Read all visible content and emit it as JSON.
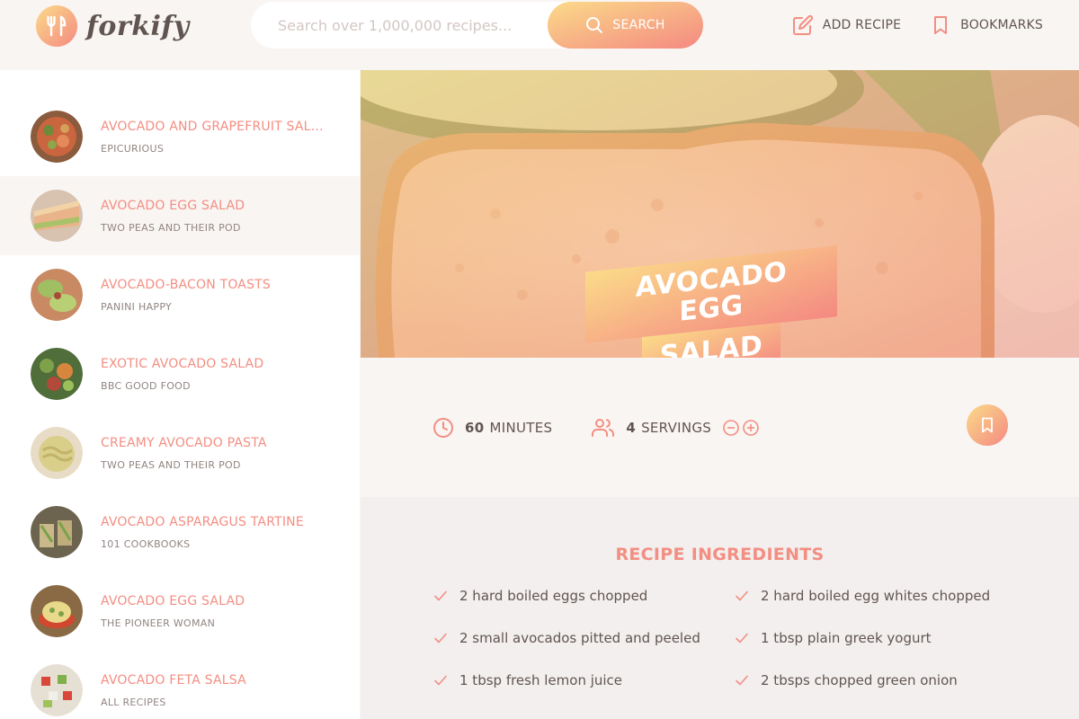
{
  "header": {
    "logo_text": "forkify",
    "search_placeholder": "Search over 1,000,000 recipes...",
    "search_label": "SEARCH",
    "nav": [
      {
        "label": "ADD RECIPE",
        "icon": "edit-icon"
      },
      {
        "label": "BOOKMARKS",
        "icon": "bookmark-icon"
      }
    ]
  },
  "results": [
    {
      "title": "AVOCADO AND GRAPEFRUIT SAL...",
      "publisher": "EPICURIOUS",
      "active": false
    },
    {
      "title": "AVOCADO EGG SALAD",
      "publisher": "TWO PEAS AND THEIR POD",
      "active": true
    },
    {
      "title": "AVOCADO-BACON TOASTS",
      "publisher": "PANINI HAPPY",
      "active": false
    },
    {
      "title": "EXOTIC AVOCADO SALAD",
      "publisher": "BBC GOOD FOOD",
      "active": false
    },
    {
      "title": "CREAMY AVOCADO PASTA",
      "publisher": "TWO PEAS AND THEIR POD",
      "active": false
    },
    {
      "title": "AVOCADO ASPARAGUS TARTINE",
      "publisher": "101 COOKBOOKS",
      "active": false
    },
    {
      "title": "AVOCADO EGG SALAD",
      "publisher": "THE PIONEER WOMAN",
      "active": false
    },
    {
      "title": "AVOCADO FETA SALSA",
      "publisher": "ALL RECIPES",
      "active": false
    }
  ],
  "recipe": {
    "title_line1": "AVOCADO EGG",
    "title_line2": "SALAD",
    "cooking_time": "60",
    "time_unit": "MINUTES",
    "servings": "4",
    "servings_unit": "SERVINGS",
    "ingredients_heading": "RECIPE INGREDIENTS",
    "ingredients": [
      "2 hard boiled eggs chopped",
      "2 hard boiled egg whites chopped",
      "2 small avocados pitted and peeled",
      "1 tbsp plain greek yogurt",
      "1 tbsp fresh lemon juice",
      "2 tbsps chopped green onion"
    ]
  },
  "colors": {
    "accent": "#f38e82",
    "gradient_start": "#fbdb89",
    "gradient_end": "#f48982",
    "background": "#f9f5f3",
    "text": "#615551"
  }
}
